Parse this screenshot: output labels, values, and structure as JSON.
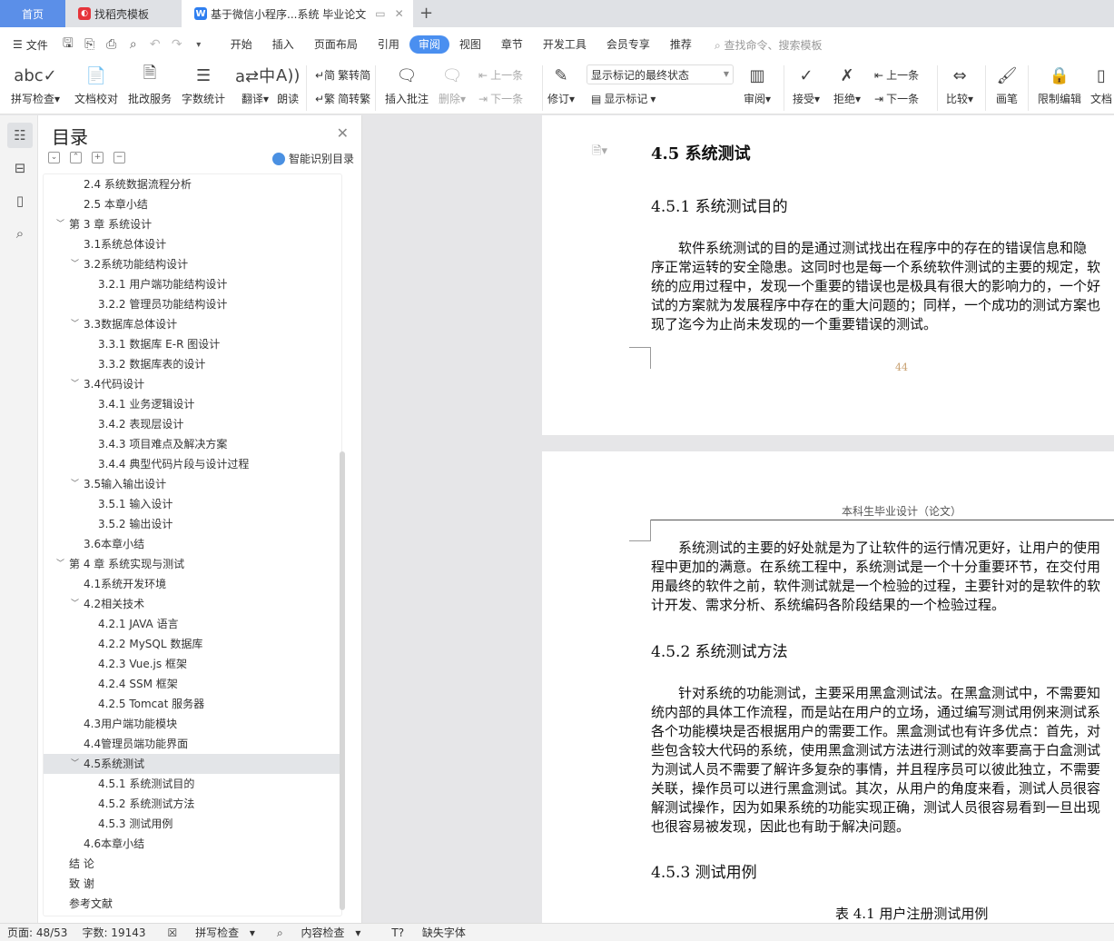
{
  "tabs": {
    "home": "首页",
    "template": "找稻壳模板",
    "doc": "基于微信小程序...系统 毕业论文",
    "new": "+"
  },
  "menu": {
    "file": "文件",
    "items": [
      "开始",
      "插入",
      "页面布局",
      "引用",
      "审阅",
      "视图",
      "章节",
      "开发工具",
      "会员专享",
      "推荐"
    ],
    "active": "审阅",
    "search": "查找命令、搜索模板"
  },
  "ribbon": {
    "spell": "拼写检查",
    "proof": "文档校对",
    "correct": "批改服务",
    "wordcount": "字数统计",
    "translate": "翻译",
    "read": "朗读",
    "t2s": "繁转简",
    "s2t": "简转繁",
    "insert_comment": "插入批注",
    "delete": "删除",
    "prev_comment": "上一条",
    "next_comment": "下一条",
    "revise": "修订",
    "markup_state": "显示标记的最终状态",
    "show_markup": "显示标记",
    "review": "审阅",
    "accept": "接受",
    "reject": "拒绝",
    "prev": "上一条",
    "next": "下一条",
    "compare": "比较",
    "pen": "画笔",
    "restrict": "限制编辑",
    "docpriv": "文档"
  },
  "panel": {
    "title": "目录",
    "smart": "智能识别目录",
    "outline": [
      {
        "t": "2.4 系统数据流程分析",
        "l": 2
      },
      {
        "t": "2.5 本章小结",
        "l": 2
      },
      {
        "t": "第 3 章  系统设计",
        "l": 1,
        "x": true
      },
      {
        "t": "3.1系统总体设计",
        "l": 2
      },
      {
        "t": "3.2系统功能结构设计",
        "l": 2,
        "x": true
      },
      {
        "t": "3.2.1 用户端功能结构设计",
        "l": 3
      },
      {
        "t": "3.2.2 管理员功能结构设计",
        "l": 3
      },
      {
        "t": "3.3数据库总体设计",
        "l": 2,
        "x": true
      },
      {
        "t": "3.3.1  数据库 E-R 图设计",
        "l": 3
      },
      {
        "t": "3.3.2  数据库表的设计",
        "l": 3
      },
      {
        "t": "3.4代码设计",
        "l": 2,
        "x": true
      },
      {
        "t": "3.4.1 业务逻辑设计",
        "l": 3
      },
      {
        "t": "3.4.2 表现层设计",
        "l": 3
      },
      {
        "t": "3.4.3 项目难点及解决方案",
        "l": 3
      },
      {
        "t": "3.4.4 典型代码片段与设计过程",
        "l": 3
      },
      {
        "t": "3.5输入输出设计",
        "l": 2,
        "x": true
      },
      {
        "t": "3.5.1 输入设计",
        "l": 3
      },
      {
        "t": "3.5.2 输出设计",
        "l": 3
      },
      {
        "t": "3.6本章小结",
        "l": 2
      },
      {
        "t": "第 4 章  系统实现与测试",
        "l": 1,
        "x": true
      },
      {
        "t": "4.1系统开发环境",
        "l": 2
      },
      {
        "t": "4.2相关技术",
        "l": 2,
        "x": true
      },
      {
        "t": "4.2.1 JAVA 语言",
        "l": 3
      },
      {
        "t": "4.2.2 MySQL 数据库",
        "l": 3
      },
      {
        "t": "4.2.3 Vue.js 框架",
        "l": 3
      },
      {
        "t": "4.2.4 SSM 框架",
        "l": 3
      },
      {
        "t": "4.2.5 Tomcat 服务器",
        "l": 3
      },
      {
        "t": "4.3用户端功能模块",
        "l": 2
      },
      {
        "t": "4.4管理员端功能界面",
        "l": 2
      },
      {
        "t": "4.5系统测试",
        "l": 2,
        "x": true,
        "sel": true
      },
      {
        "t": "4.5.1  系统测试目的",
        "l": 3
      },
      {
        "t": "4.5.2  系统测试方法",
        "l": 3
      },
      {
        "t": "4.5.3  测试用例",
        "l": 3
      },
      {
        "t": "4.6本章小结",
        "l": 2
      },
      {
        "t": "结   论",
        "l": 1
      },
      {
        "t": "致   谢",
        "l": 1
      },
      {
        "t": "参考文献",
        "l": 1
      }
    ]
  },
  "doc": {
    "h_45": "4.5  系统测试",
    "h_451": "4.5.1  系统测试目的",
    "p1": [
      "　　软件系统测试的目的是通过测试找出在程序中的存在的错误信息和隐",
      "序正常运转的安全隐患。这同时也是每一个系统软件测试的主要的规定，软",
      "统的应用过程中，发现一个重要的错误也是极具有很大的影响力的，一个好",
      "试的方案就为发展程序中存在的重大问题的；同样，一个成功的测试方案也",
      "现了迄今为止尚未发现的一个重要错误的测试。"
    ],
    "page_no": "44",
    "header": "本科生毕业设计（论文）",
    "p2": [
      "　　系统测试的主要的好处就是为了让软件的运行情况更好，让用户的使用",
      "程中更加的满意。在系统工程中，系统测试是一个十分重要环节，在交付用",
      "用最终的软件之前，软件测试就是一个检验的过程，主要针对的是软件的软",
      "计开发、需求分析、系统编码各阶段结果的一个检验过程。"
    ],
    "h_452": "4.5.2  系统测试方法",
    "p3": [
      "　　针对系统的功能测试，主要采用黑盒测试法。在黑盒测试中，不需要知",
      "统内部的具体工作流程，而是站在用户的立场，通过编写测试用例来测试系",
      "各个功能模块是否根据用户的需要工作。黑盒测试也有许多优点：首先，对",
      "些包含较大代码的系统，使用黑盒测试方法进行测试的效率要高于白盒测试",
      "为测试人员不需要了解许多复杂的事情，并且程序员可以彼此独立，不需要",
      "关联，操作员可以进行黑盒测试。其次，从用户的角度来看，测试人员很容",
      "解测试操作，因为如果系统的功能实现正确，测试人员很容易看到一旦出现",
      "也很容易被发现，因此也有助于解决问题。"
    ],
    "h_453": "4.5.3  测试用例",
    "table_caption": "表 4.1  用户注册测试用例"
  },
  "status": {
    "page": "页面: 48/53",
    "words": "字数: 19143",
    "spell": "拼写检查",
    "content": "内容检查",
    "font": "缺失字体"
  }
}
